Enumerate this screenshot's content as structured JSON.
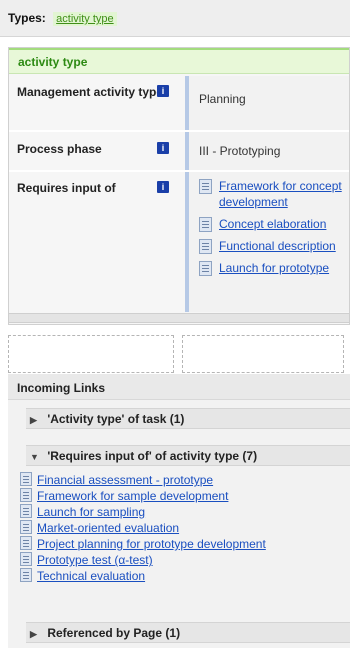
{
  "types": {
    "label": "Types:",
    "link": "activity type"
  },
  "header": {
    "title": "activity type"
  },
  "properties": [
    {
      "name": "Management activity type",
      "value": "Planning"
    },
    {
      "name": "Process phase",
      "value": "III - Prototyping"
    },
    {
      "name": "Requires input of",
      "values": [
        "Framework for concept development",
        "Concept elaboration",
        "Functional description",
        "Launch for prototype"
      ]
    }
  ],
  "incoming": {
    "title": "Incoming Links",
    "sections": [
      {
        "label": "'Activity type' of task (1)",
        "state": "collapsed"
      },
      {
        "label": "'Requires input of' of activity type (7)",
        "state": "expanded",
        "links": [
          "Financial assessment - prototype",
          "Framework for sample development",
          "Launch for sampling",
          "Market-oriented evaluation",
          "Project planning for prototype development",
          "Prototype test (α-test)",
          "Technical evaluation"
        ]
      },
      {
        "label": "Referenced by Page (1)",
        "state": "collapsed"
      }
    ]
  },
  "icons": {
    "info": "info-icon",
    "page": "page-icon",
    "collapsed": "triangle-right-icon",
    "expanded": "triangle-down-icon"
  }
}
